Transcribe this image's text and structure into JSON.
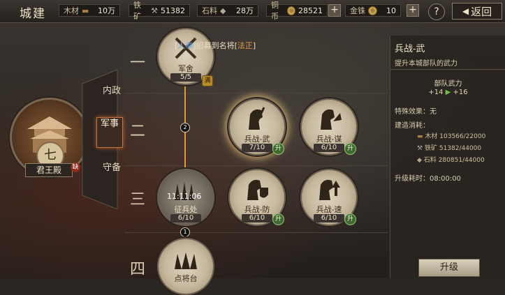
{
  "header": {
    "title": "城建",
    "resources": [
      {
        "label": "木材",
        "value": "10万"
      },
      {
        "label": "铁矿",
        "value": "51382"
      },
      {
        "label": "石料",
        "value": "28万"
      }
    ],
    "copper": {
      "label": "铜币",
      "value": "28521"
    },
    "gold": {
      "label": "金铢",
      "value": "10"
    },
    "help": "?",
    "back": "返回"
  },
  "palace": {
    "level": "七",
    "name": "君王殿",
    "queue_badge": "缺"
  },
  "tabs": {
    "items": [
      "内政",
      "军事",
      "守备"
    ],
    "active": "军事"
  },
  "tree": {
    "rows": [
      "一",
      "二",
      "三",
      "四"
    ],
    "notice": {
      "prefix": "[",
      "hero": "人奉",
      "mid": "]招募到名将[",
      "general": "法正",
      "suffix": "]"
    },
    "nodes": [
      {
        "name": "军舍",
        "progress": "5/5",
        "badge": "满"
      },
      {
        "name": "兵战-武",
        "progress": "7/10",
        "badge": "升"
      },
      {
        "name": "兵战-谋",
        "progress": "6/10",
        "badge": "升"
      },
      {
        "name": "征兵处",
        "progress": "6/10",
        "timer": "11:11:06"
      },
      {
        "name": "兵战-防",
        "progress": "6/10",
        "badge": "升"
      },
      {
        "name": "兵战-速",
        "progress": "6/10",
        "badge": "升"
      },
      {
        "name": "点将台",
        "progress": ""
      }
    ],
    "connector_counts": [
      "2",
      "1"
    ]
  },
  "panel": {
    "title": "兵战-武",
    "description": "提升本城部队的武力",
    "effect_title": "部队武力",
    "effect_current": "+14",
    "effect_next": "+16",
    "special_label": "特殊效果：无",
    "cost_label": "建造消耗：",
    "costs": [
      {
        "label": "木材",
        "value": "103566/22000"
      },
      {
        "label": "铁矿",
        "value": "51382/44000"
      },
      {
        "label": "石料",
        "value": "280851/44000"
      }
    ],
    "time_label": "升级耗时：",
    "time_value": "08:00:00",
    "upgrade_button": "升级"
  },
  "colors": {
    "accent_orange": "#e09a3a",
    "upgrade_green": "#3f6a2f",
    "link_blue": "#6aa6e6",
    "general_orange": "#e49a4a"
  }
}
